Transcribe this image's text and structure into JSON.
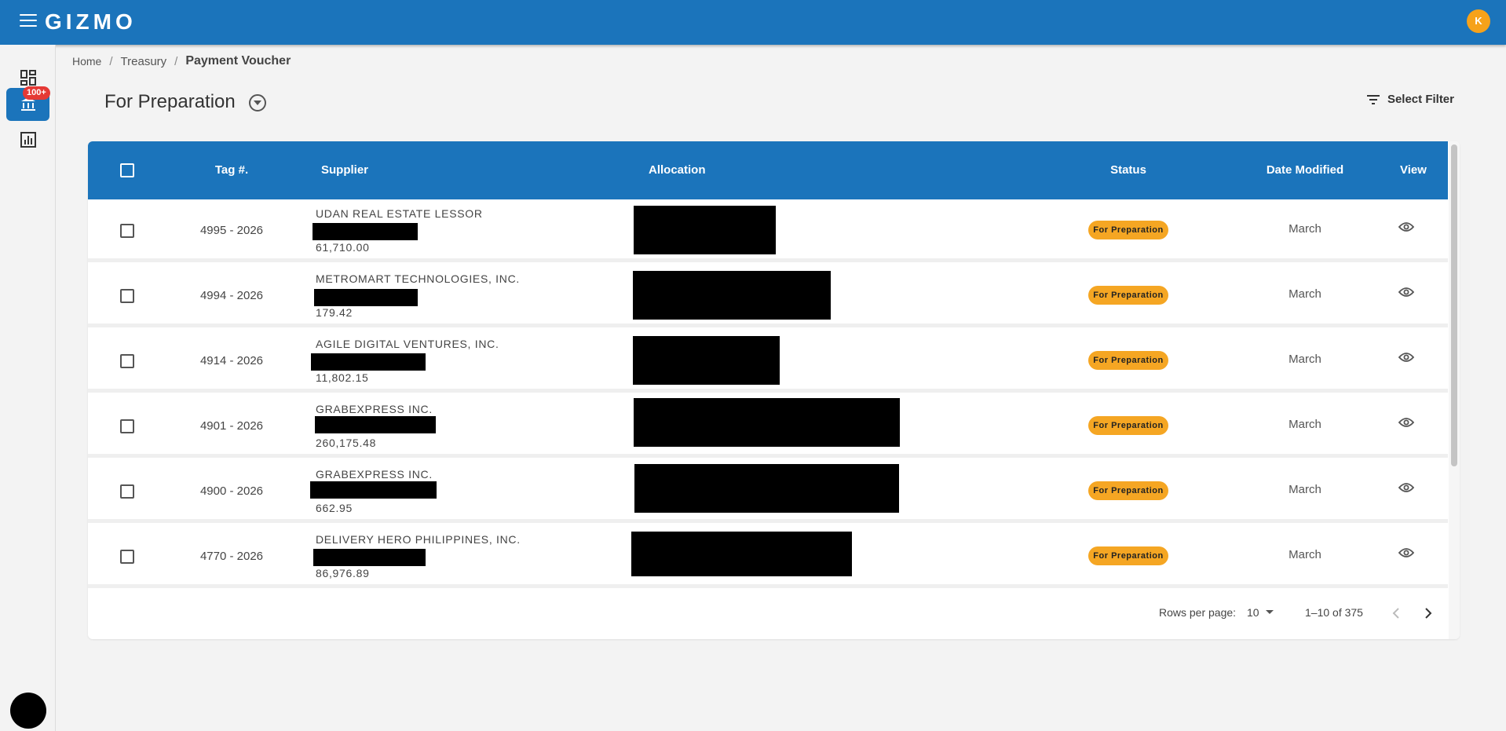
{
  "app": {
    "logo": "GIZMO",
    "user_initial": "K"
  },
  "nav": {
    "badge": "100+"
  },
  "breadcrumb": {
    "home": "Home",
    "section": "Treasury",
    "current": "Payment Voucher"
  },
  "view": {
    "title": "For Preparation",
    "filter_label": "Select Filter"
  },
  "table": {
    "headers": {
      "tag": "Tag #.",
      "supplier": "Supplier",
      "allocation": "Allocation",
      "status": "Status",
      "date": "Date Modified",
      "view": "View"
    },
    "rows": [
      {
        "tag": "4995 - 2026",
        "supplier": "UDAN REAL ESTATE LESSOR",
        "amount": "61,710.00",
        "status": "For Preparation",
        "date": "March"
      },
      {
        "tag": "4994 - 2026",
        "supplier": "METROMART TECHNOLOGIES, INC.",
        "amount": "179.42",
        "status": "For Preparation",
        "date": "March"
      },
      {
        "tag": "4914 - 2026",
        "supplier": "AGILE DIGITAL VENTURES, INC.",
        "amount": "11,802.15",
        "status": "For Preparation",
        "date": "March"
      },
      {
        "tag": "4901 - 2026",
        "supplier": "GRABEXPRESS INC.",
        "amount": "260,175.48",
        "status": "For Preparation",
        "date": "March"
      },
      {
        "tag": "4900 - 2026",
        "supplier": "GRABEXPRESS INC.",
        "amount": "662.95",
        "status": "For Preparation",
        "date": "March"
      },
      {
        "tag": "4770 - 2026",
        "supplier": "DELIVERY HERO PHILIPPINES, INC.",
        "amount": "86,976.89",
        "status": "For Preparation",
        "date": "March"
      }
    ]
  },
  "pagination": {
    "rows_label": "Rows per page:",
    "rows_value": "10",
    "range": "1–10 of 375"
  },
  "colors": {
    "primary": "#1b74bb",
    "badge_status": "#f5a623",
    "avatar": "#f6a21a",
    "nav_badge": "#e53935"
  }
}
